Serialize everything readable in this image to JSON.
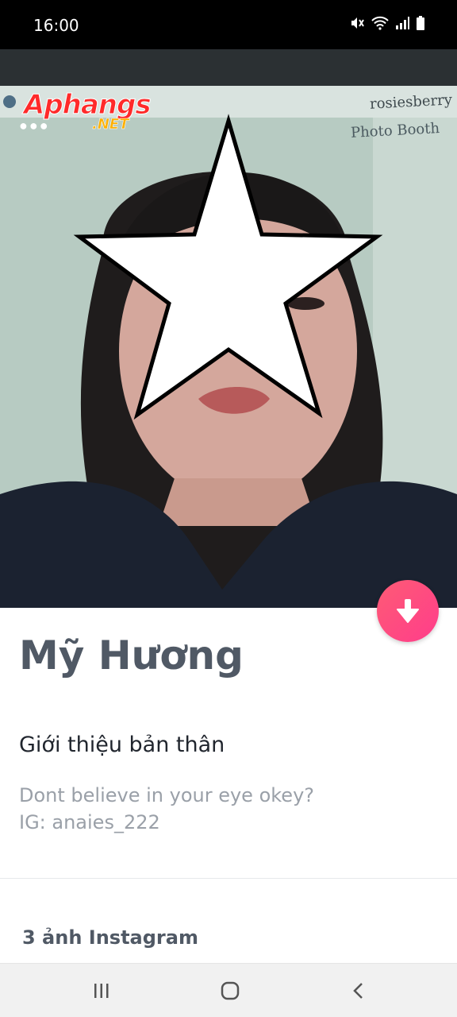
{
  "status_bar": {
    "time": "16:00",
    "icons": [
      "mute-icon",
      "wifi-icon",
      "signal-icon",
      "battery-icon"
    ]
  },
  "watermark": {
    "title": "Aphangs",
    "subtitle": ".NET"
  },
  "photo_overlay": {
    "line1": "rosiesberry",
    "line2": "Photo Booth"
  },
  "profile": {
    "name": "Mỹ Hương",
    "about_heading": "Giới thiệu bản thân",
    "bio_line1": "Dont believe in your eye okey?",
    "bio_line2": "IG: anaies_222",
    "instagram_heading": "3 ảnh Instagram"
  },
  "colors": {
    "accent_gradient_start": "#fe5b75",
    "accent_gradient_end": "#ff3d8b",
    "name_text": "#505965",
    "bio_text": "#9aa0a8"
  },
  "nav": {
    "buttons": [
      "recent-apps-icon",
      "home-icon",
      "back-icon"
    ]
  }
}
